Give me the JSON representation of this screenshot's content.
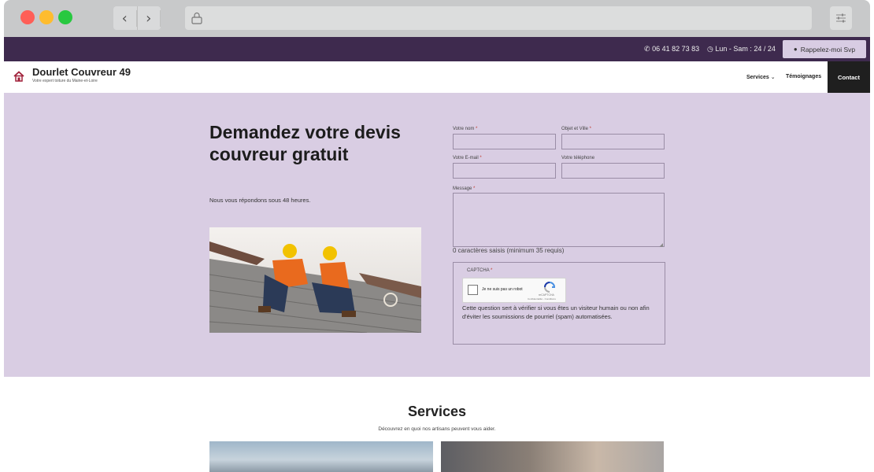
{
  "browser": {
    "icons": {
      "back": "chevron-left-icon",
      "forward": "chevron-right-icon",
      "lock": "lock-icon",
      "settings": "sliders-icon"
    },
    "window_colors": {
      "close": "#ff5f57",
      "minimize": "#febc2e",
      "maximize": "#28c840"
    }
  },
  "topbar": {
    "phone": "06 41 82 73 83",
    "hours": "Lun - Sam : 24 / 24",
    "callback_label": "Rappelez-moi Svp"
  },
  "header": {
    "brand": "Dourlet Couvreur 49",
    "tagline": "Votre expert toiture du Maine-et-Loire",
    "menu": {
      "services": "Services",
      "testimonials": "Témoignages",
      "contact": "Contact"
    }
  },
  "hero": {
    "title": "Demandez votre devis couvreur gratuit",
    "subtitle": "Nous vous répondons sous 48 heures.",
    "background": "#d9cde3"
  },
  "form": {
    "name_label": "Votre nom",
    "subject_label": "Objet et Ville",
    "email_label": "Votre E-mail",
    "phone_label": "Votre téléphone",
    "message_label": "Message",
    "required_mark": "*",
    "char_count": "0 caractères saisis (minimum 35 requis)",
    "captcha_label": "CAPTCHA",
    "recaptcha_text": "Je ne suis pas un robot",
    "recaptcha_brand": "reCAPTCHA",
    "recaptcha_terms": "Confidentialité - Conditions",
    "captcha_desc": "Cette question sert à vérifier si vous êtes un visiteur humain ou non afin d'éviter les soumissions de pourriel (spam) automatisées."
  },
  "services": {
    "title": "Services",
    "subtitle": "Découvrez en quoi nos artisans peuvent vous aider."
  },
  "colors": {
    "topbar": "#3e2a4e",
    "hero": "#d9cde3",
    "contact_button": "#1f1f1f",
    "callback_button": "#d8cce3",
    "required": "#c0392b"
  }
}
